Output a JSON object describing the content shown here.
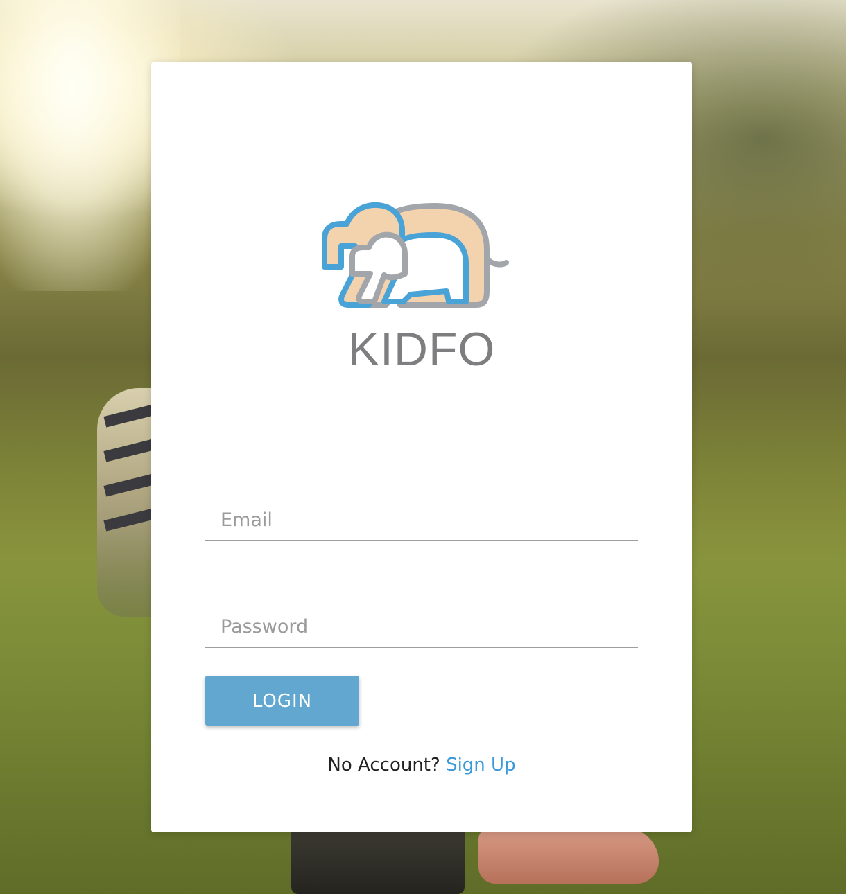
{
  "brand": {
    "name": "KIDFO",
    "logo_icon": "elephant-family-icon",
    "colors": {
      "outline_blue": "#4aa3d6",
      "outline_gray": "#a2a6aa",
      "fill_peach": "#f3d2ae",
      "text_gray": "#7e7e80"
    }
  },
  "form": {
    "email_placeholder": "Email",
    "email_value": "",
    "password_placeholder": "Password",
    "password_value": "",
    "login_label": "LOGIN",
    "no_account_text": "No Account?",
    "signup_label": "Sign Up"
  },
  "colors": {
    "button": "#62a7cf",
    "link": "#3a9ad9",
    "card": "#ffffff"
  }
}
